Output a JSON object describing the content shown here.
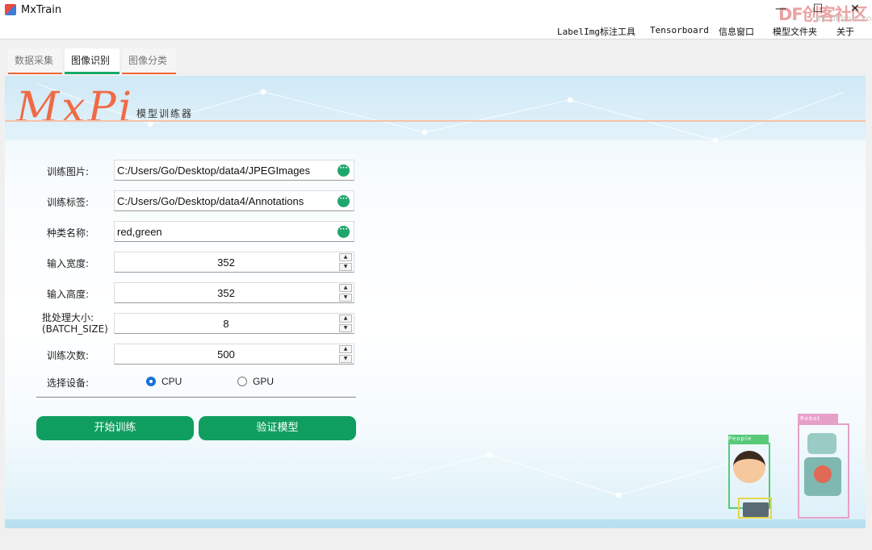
{
  "window": {
    "title": "MxTrain",
    "minimize": "—",
    "maximize": "☐",
    "close": "✕",
    "watermark": "DF创客社区",
    "watermark_sub": "mc.dfrobot.com.cn"
  },
  "menu": [
    "LabelImg标注工具",
    "Tensorboard",
    "信息窗口",
    "模型文件夹",
    "关于"
  ],
  "tabs": [
    {
      "label": "数据采集"
    },
    {
      "label": "图像识别"
    },
    {
      "label": "图像分类"
    }
  ],
  "header": {
    "brand": "MxPi",
    "subtitle": "模型训练器"
  },
  "form": {
    "train_images": {
      "label": "训练图片:",
      "value": "C:/Users/Go/Desktop/data4/JPEGImages"
    },
    "train_labels": {
      "label": "训练标签:",
      "value": "C:/Users/Go/Desktop/data4/Annotations"
    },
    "class_names": {
      "label": "种类名称:",
      "value": "red,green"
    },
    "input_width": {
      "label": "输入宽度:",
      "value": "352"
    },
    "input_height": {
      "label": "输入高度:",
      "value": "352"
    },
    "batch_size": {
      "label_line1": "批处理大小:",
      "label_line2": "(BATCH_SIZE)",
      "value": "8"
    },
    "epochs": {
      "label": "训练次数:",
      "value": "500"
    },
    "device": {
      "label": "选择设备:",
      "options": [
        "CPU",
        "GPU"
      ],
      "selected": "CPU"
    }
  },
  "buttons": {
    "start_training": "开始训练",
    "validate_model": "验证模型"
  },
  "illustration": {
    "tag_people": "People",
    "tag_robot": "Robot"
  },
  "icons": {
    "more": "more-dots-icon",
    "spin_up": "triangle-up-icon",
    "spin_down": "triangle-down-icon"
  },
  "colors": {
    "accent_green": "#0f9e5f",
    "tab_orange": "#ee6a3a",
    "brand_orange": "#f06a45",
    "radio_blue": "#1572d6"
  }
}
